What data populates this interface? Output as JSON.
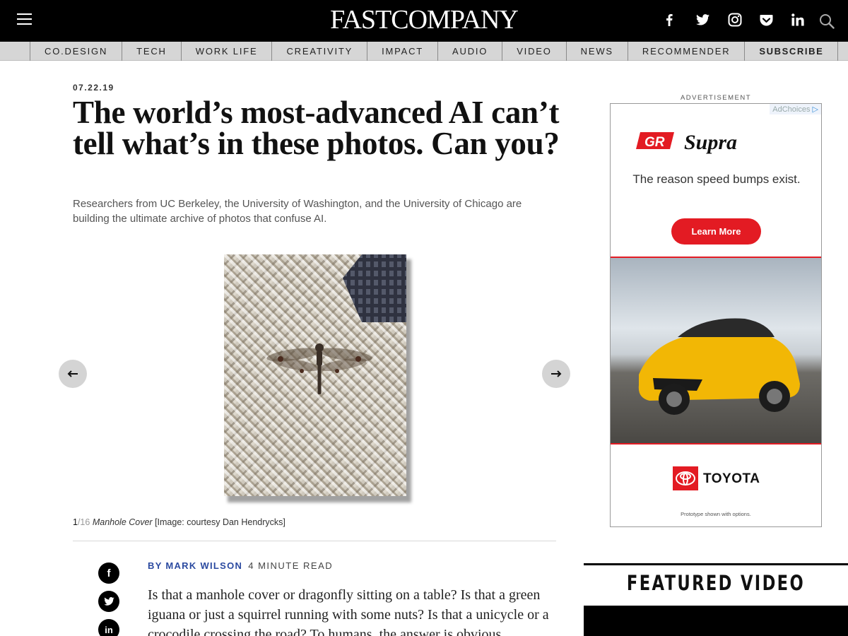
{
  "header": {
    "logo": "FASTCOMPANY",
    "social": [
      "facebook-icon",
      "twitter-icon",
      "instagram-icon",
      "pocket-icon",
      "linkedin-icon",
      "search-icon"
    ]
  },
  "nav": {
    "items": [
      "CO.DESIGN",
      "TECH",
      "WORK LIFE",
      "CREATIVITY",
      "IMPACT",
      "AUDIO",
      "VIDEO",
      "NEWS",
      "RECOMMENDER",
      "SUBSCRIBE"
    ]
  },
  "article": {
    "date": "07.22.19",
    "headline": "The world’s most-advanced AI can’t tell what’s in these photos. Can you?",
    "dek": "Researchers from UC Berkeley, the University of Washington, and the University of Chicago are building the ultimate archive of photos that confuse AI.",
    "slideshow": {
      "current": "1",
      "total": "/16",
      "title": "Manhole Cover",
      "credit": " [Image: courtesy Dan Hendrycks]"
    },
    "byline_prefix": "BY ",
    "author": "MARK WILSON",
    "read_time": "4 MINUTE READ",
    "body": "Is that a manhole cover or dragonfly sitting on a table? Is that a green iguana or just a squirrel running with some nuts? Is that a unicycle or a crocodile crossing the road? To humans, the answer is obvious."
  },
  "ad": {
    "label": "ADVERTISEMENT",
    "adchoices": "AdChoices",
    "model": "Supra",
    "badge": "GR",
    "tagline": "The reason speed bumps exist.",
    "cta": "Learn More",
    "brand": "TOYOTA",
    "fine_print": "Prototype shown with options.",
    "accent": "#e31b23"
  },
  "featured_video": {
    "title": "FEATURED VIDEO"
  },
  "share": {
    "facebook": "f",
    "twitter": "t",
    "linkedin": "in"
  }
}
